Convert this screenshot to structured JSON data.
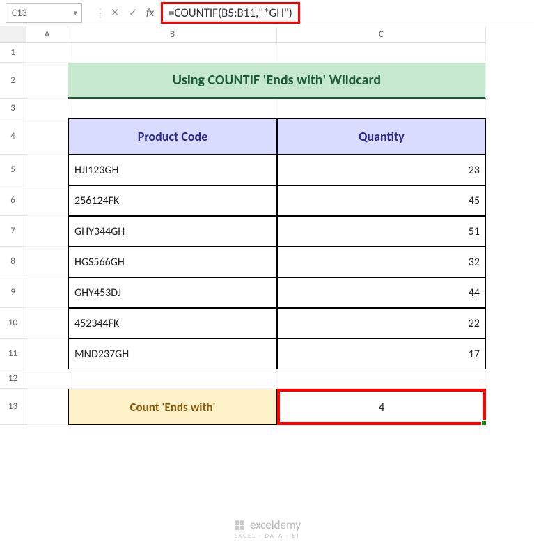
{
  "namebox": "C13",
  "formula": "=COUNTIF(B5:B11,\"*GH\")",
  "columns": [
    "A",
    "B",
    "C"
  ],
  "rows": [
    "1",
    "2",
    "3",
    "4",
    "5",
    "6",
    "7",
    "8",
    "9",
    "10",
    "11",
    "12",
    "13"
  ],
  "title": "Using COUNTIF 'Ends with' Wildcard",
  "headers": {
    "b": "Product Code",
    "c": "Quantity"
  },
  "data": [
    {
      "code": "HJI123GH",
      "qty": "23"
    },
    {
      "code": "256124FK",
      "qty": "45"
    },
    {
      "code": "GHY344GH",
      "qty": "51"
    },
    {
      "code": "HGS566GH",
      "qty": "32"
    },
    {
      "code": "GHY453DJ",
      "qty": "44"
    },
    {
      "code": "452344FK",
      "qty": "22"
    },
    {
      "code": "MND237GH",
      "qty": "17"
    }
  ],
  "count_label": "Count  'Ends with'",
  "count_value": "4",
  "watermark": {
    "text": "exceldemy",
    "sub": "EXCEL · DATA · BI"
  }
}
